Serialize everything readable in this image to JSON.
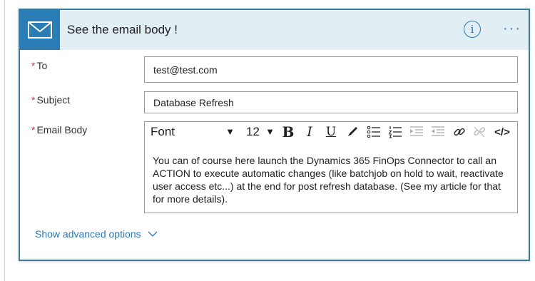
{
  "header": {
    "title": "See the email body !",
    "accent_color": "#2a7db5",
    "icons": [
      "mail-icon",
      "info-icon",
      "more-icon"
    ]
  },
  "fields": {
    "to": {
      "label": "To",
      "required_mark": "*",
      "value": "test@test.com"
    },
    "subject": {
      "label": "Subject",
      "required_mark": "*",
      "value": "Database Refresh"
    },
    "body": {
      "label": "Email Body",
      "required_mark": "*",
      "toolbar": {
        "font": "Font",
        "size": "12",
        "bold": "B",
        "italic": "I",
        "underline": "U",
        "code": "</>"
      },
      "content": "You can of course here launch the Dynamics 365 FinOps Connector to call an ACTION to execute automatic changes (like batchjob on hold to wait, reactivate user access etc...) at the end for post refresh database. (See my article for that for more details)."
    }
  },
  "advanced": {
    "label": "Show advanced options"
  }
}
